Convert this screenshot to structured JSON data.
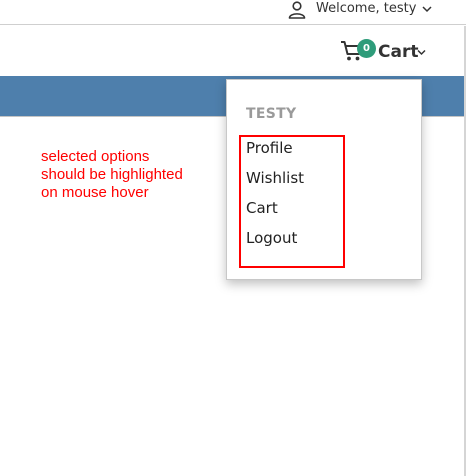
{
  "topbar": {
    "welcome_text": "Welcome, testy",
    "user_icon": "user-icon",
    "chevron_icon": "chevron-down-icon"
  },
  "header": {
    "cart_icon": "shopping-cart-icon",
    "cart_count": "0",
    "cart_label": "Cart",
    "chevron_icon": "chevron-down-icon"
  },
  "navbar": {
    "color": "#4e7fac"
  },
  "dropdown": {
    "title": "TESTY",
    "items": [
      {
        "label": "Profile"
      },
      {
        "label": "Wishlist"
      },
      {
        "label": "Cart"
      },
      {
        "label": "Logout"
      }
    ]
  },
  "annotation": {
    "lines": [
      "selected options",
      "should be highlighted",
      "on mouse hover"
    ],
    "color": "#ff0000"
  },
  "colors": {
    "badge": "#2e9c7a",
    "annotation_red": "#ff0000"
  }
}
